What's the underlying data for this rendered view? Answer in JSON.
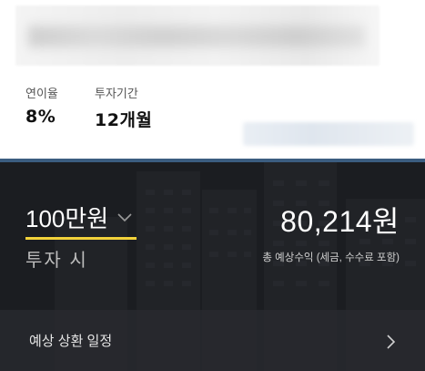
{
  "summary": {
    "rate_label": "연이율",
    "rate_value": "8%",
    "period_label": "투자기간",
    "period_value": "12개월"
  },
  "investment": {
    "amount": "100만원",
    "amount_label": "투자 시"
  },
  "result": {
    "total": "80,214원",
    "caption": "총 예상수익 (세금, 수수료 포함)"
  },
  "schedule": {
    "label": "예상 상환 일정"
  },
  "colors": {
    "accent_underline": "#f3d23a",
    "dark_bg": "#1d1f22",
    "divider": "#3b5d80"
  },
  "icons": {
    "dropdown": "chevron-down-icon",
    "next": "chevron-right-icon"
  }
}
